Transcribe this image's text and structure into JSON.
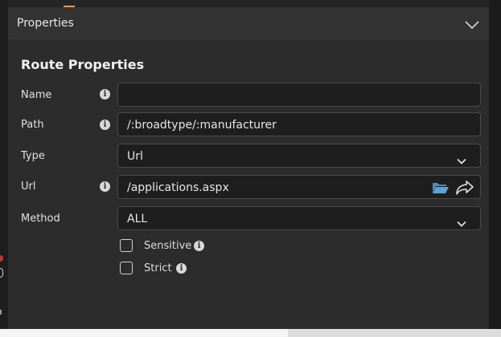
{
  "panel": {
    "header_title": "Properties",
    "section_title": "Route Properties"
  },
  "form": {
    "name": {
      "label": "Name",
      "value": ""
    },
    "path": {
      "label": "Path",
      "value": "/:broadtype/:manufacturer"
    },
    "type": {
      "label": "Type",
      "value": "Url"
    },
    "url": {
      "label": "Url",
      "value": "/applications.aspx"
    },
    "method": {
      "label": "Method",
      "value": "ALL"
    },
    "sensitive": {
      "label": "Sensitive",
      "checked": false
    },
    "strict": {
      "label": "Strict",
      "checked": false
    }
  },
  "icons": {
    "info": "i",
    "header_toggle": "chevron-down-icon",
    "browse": "folder-open-icon",
    "navigate": "share-arrow-icon"
  },
  "colors": {
    "panel_bg": "#2c2c2d",
    "field_bg": "#1e1e1f",
    "folder_accent": "#5ba3d9",
    "tab_indicator": "#e59b5b"
  }
}
